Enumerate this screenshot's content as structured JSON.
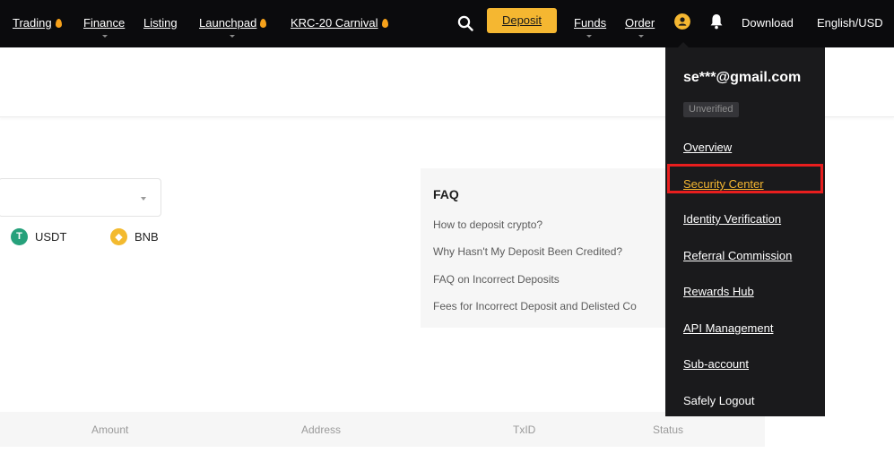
{
  "colors": {
    "accent": "#f5b731",
    "highlight_border": "#e81e1e",
    "nav_bg": "#0b0b0d",
    "menu_bg": "#1a1a1c",
    "flame": "#f7a21b",
    "usdt": "#26a17b",
    "bnb": "#f3ba2f"
  },
  "nav": {
    "trading": "Trading",
    "finance": "Finance",
    "listing": "Listing",
    "launchpad": "Launchpad",
    "carnival": "KRC-20 Carnival",
    "deposit": "Deposit",
    "funds": "Funds",
    "order": "Order",
    "download": "Download",
    "locale": "English/USD"
  },
  "icons": {
    "search": "search-icon",
    "user": "user-icon",
    "bell": "bell-icon",
    "flame": "flame-icon"
  },
  "coins": [
    {
      "symbol": "USDT",
      "badge_glyph": "T"
    },
    {
      "symbol": "BNB",
      "badge_glyph": "◆"
    }
  ],
  "faq": {
    "title": "FAQ",
    "links": [
      "How to deposit crypto?",
      "Why Hasn't My Deposit Been Credited?",
      "FAQ on Incorrect Deposits",
      "Fees for Incorrect Deposit and Delisted Co"
    ]
  },
  "table": {
    "headers": [
      "Amount",
      "Address",
      "TxID",
      "Status"
    ]
  },
  "user_menu": {
    "email": "se***@gmail.com",
    "verification_status": "Unverified",
    "items": [
      "Overview",
      "Security Center",
      "Identity Verification",
      "Referral Commission",
      "Rewards Hub",
      "API Management",
      "Sub-account",
      "Safely Logout"
    ]
  }
}
